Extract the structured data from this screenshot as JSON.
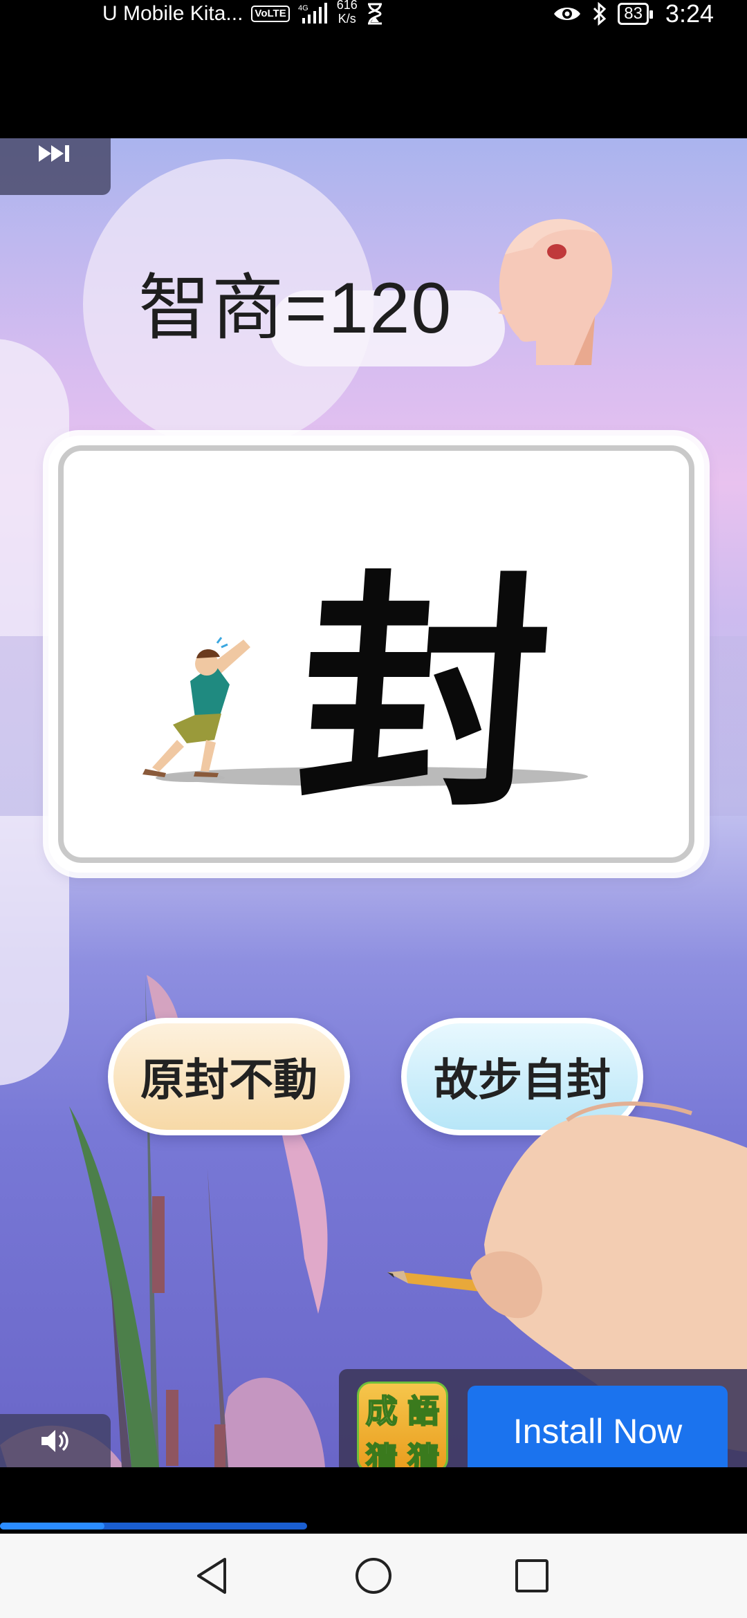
{
  "status_bar": {
    "carrier": "U Mobile Kita...",
    "volte": "VoLTE",
    "network": "4G",
    "speed_value": "616",
    "speed_unit": "K/s",
    "battery": "83",
    "time": "3:24"
  },
  "ad": {
    "iq_text": "智商=120",
    "puzzle_character": "封",
    "answers": [
      "原封不動",
      "故步自封"
    ],
    "app_icon_chars": [
      "成",
      "語",
      "猜",
      "猜"
    ],
    "install_label": "Install Now",
    "progress": 0.34
  },
  "icons": {
    "skip": "skip-forward-icon",
    "sound": "volume-icon",
    "back": "back-triangle-icon",
    "home": "home-circle-icon",
    "recents": "recents-square-icon"
  }
}
